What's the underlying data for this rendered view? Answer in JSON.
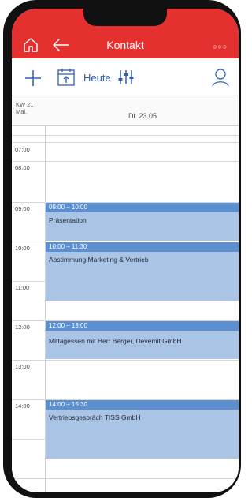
{
  "header": {
    "title": "Kontakt",
    "home_icon": "home-icon",
    "back_icon": "arrow-left-icon",
    "more_icon": "more-dots-icon",
    "background": "#e4302f"
  },
  "toolbar": {
    "add_icon": "plus-icon",
    "calendar_icon": "calendar-upload-icon",
    "today_label": "Heute",
    "filter_icon": "sliders-icon",
    "person_icon": "person-icon",
    "accent": "#2f5fb3"
  },
  "calendar": {
    "week_label": "KW 21",
    "month_label": "Mai.",
    "day_label": "Di. 23.05",
    "hours": [
      "07:00",
      "08:00",
      "09:00",
      "10:00",
      "11:00",
      "12:00",
      "13:00",
      "14:00"
    ],
    "events": [
      {
        "time": "09:00 – 10:00",
        "title": "Präsentation"
      },
      {
        "time": "10:00 – 11:30",
        "title": "Abstimmung Marketing & Vertrieb"
      },
      {
        "time": "12:00 – 13:00",
        "title": "Mittagessen mit Herr Berger, Devemit GmbH"
      },
      {
        "time": "14:00 – 15:30",
        "title": "Vertriebsgespräch TISS GmbH"
      }
    ]
  }
}
